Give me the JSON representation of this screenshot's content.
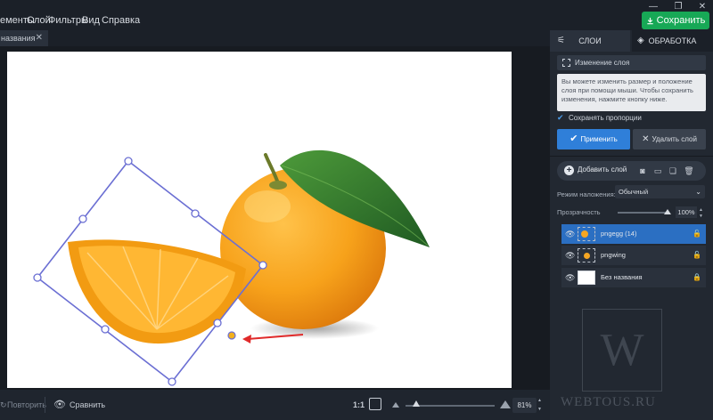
{
  "menu": {
    "items": [
      "ементы",
      "Слой",
      "Фильтры",
      "Вид",
      "Справка"
    ],
    "save_label": "Сохранить"
  },
  "document_tab": {
    "title": "названия"
  },
  "bottom": {
    "redo_label": "Повторить",
    "compare_label": "Сравнить",
    "ratio_label": "1:1",
    "zoom_value": "81%"
  },
  "panel": {
    "tabs": {
      "layers": "СЛОИ",
      "processing": "ОБРАБОТКА"
    },
    "resize_label": "Изменение слоя",
    "info_text": "Вы можете изменить размер и положение слоя при помощи мыши. Чтобы сохранить изменения, нажмите кнопку ниже.",
    "keep_proportions": "Сохранять пропорции",
    "apply_label": "Применить",
    "delete_label": "Удалить слой",
    "add_layer_label": "Добавить слой",
    "blend_label": "Режим наложения:",
    "blend_value": "Обычный",
    "opacity_label": "Прозрачность",
    "opacity_value": "100%",
    "layers": [
      {
        "name": "pngegg (14)",
        "selected": true
      },
      {
        "name": "pngwing",
        "selected": false
      },
      {
        "name": "Без названия",
        "selected": false
      }
    ]
  },
  "watermark": {
    "text": "WEBTOUS.RU",
    "letter": "W"
  },
  "colors": {
    "accent": "#2f7fd9",
    "save": "#17a856",
    "selection": "#6b6fd3",
    "arrow": "#e02a2a"
  }
}
